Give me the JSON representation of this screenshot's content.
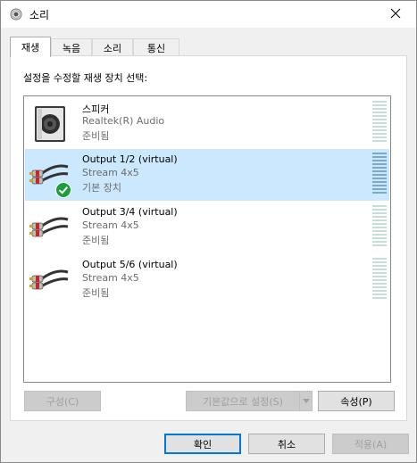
{
  "window": {
    "title": "소리",
    "title_icon": "speaker-icon",
    "close_icon": "close-icon"
  },
  "tabs": [
    {
      "label": "재생",
      "active": true
    },
    {
      "label": "녹음",
      "active": false
    },
    {
      "label": "소리",
      "active": false
    },
    {
      "label": "통신",
      "active": false
    }
  ],
  "panel": {
    "caption": "설정을 수정할 재생 장치 선택:"
  },
  "devices": [
    {
      "name": "스피커",
      "detail": "Realtek(R) Audio",
      "status": "준비됨",
      "icon": "speaker-box-icon",
      "selected": false,
      "default": false
    },
    {
      "name": "Output 1/2 (virtual)",
      "detail": "Stream 4x5",
      "status": "기본 장치",
      "icon": "rca-cable-icon",
      "selected": true,
      "default": true
    },
    {
      "name": "Output 3/4 (virtual)",
      "detail": "Stream 4x5",
      "status": "준비됨",
      "icon": "rca-cable-icon",
      "selected": false,
      "default": false
    },
    {
      "name": "Output 5/6 (virtual)",
      "detail": "Stream 4x5",
      "status": "준비됨",
      "icon": "rca-cable-icon",
      "selected": false,
      "default": false
    }
  ],
  "panel_buttons": {
    "configure": "구성(C)",
    "set_default": "기본값으로 설정(S)",
    "properties": "속성(P)"
  },
  "dialog_buttons": {
    "ok": "확인",
    "cancel": "취소",
    "apply": "적용(A)"
  },
  "colors": {
    "selection": "#cce8ff",
    "accent": "#0078d7",
    "default_check": "#1e9e3b"
  }
}
